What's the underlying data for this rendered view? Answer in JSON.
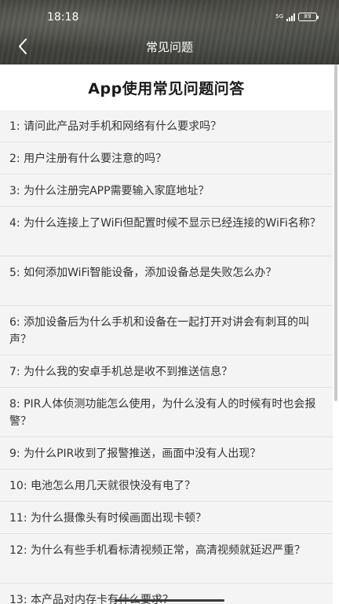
{
  "status_bar": {
    "time": "18:18",
    "network": "5G",
    "battery": "89"
  },
  "nav": {
    "title": "常见问题",
    "back_icon": "chevron-left-icon"
  },
  "page": {
    "heading": "App使用常见问题问答"
  },
  "faq_items": [
    {
      "text": "1:  请问此产品对手机和网络有什么要求吗？"
    },
    {
      "text": "2:  用户注册有什么要注意的吗？"
    },
    {
      "text": "3:  为什么注册完APP需要输入家庭地址？"
    },
    {
      "text": "4:  为什么连接上了WiFi但配置时候不显示已经连接的WiFi名称？"
    },
    {
      "text": "5:  如何添加WiFi智能设备，添加设备总是失败怎么办？"
    },
    {
      "text": "6:  添加设备后为什么手机和设备在一起打开对讲会有刺耳的叫声？"
    },
    {
      "text": "7:  为什么我的安卓手机总是收不到推送信息？"
    },
    {
      "text": "8: PIR人体侦测功能怎么使用，为什么没有人的时候有时也会报警？"
    },
    {
      "text": "9: 为什么PIR收到了报警推送，画面中没有人出现？"
    },
    {
      "text": "10:  电池怎么用几天就很快没有电了？"
    },
    {
      "text": "11:  为什么摄像头有时候画面出现卡顿？"
    },
    {
      "text": "12:  为什么有些手机看标清视频正常，高清视频就延迟严重？"
    },
    {
      "text": "13:  本产品对内存卡有什么要求？"
    }
  ],
  "colors": {
    "item_background": "#f4f4f4",
    "text": "#333333",
    "divider": "#e2e2e2"
  }
}
